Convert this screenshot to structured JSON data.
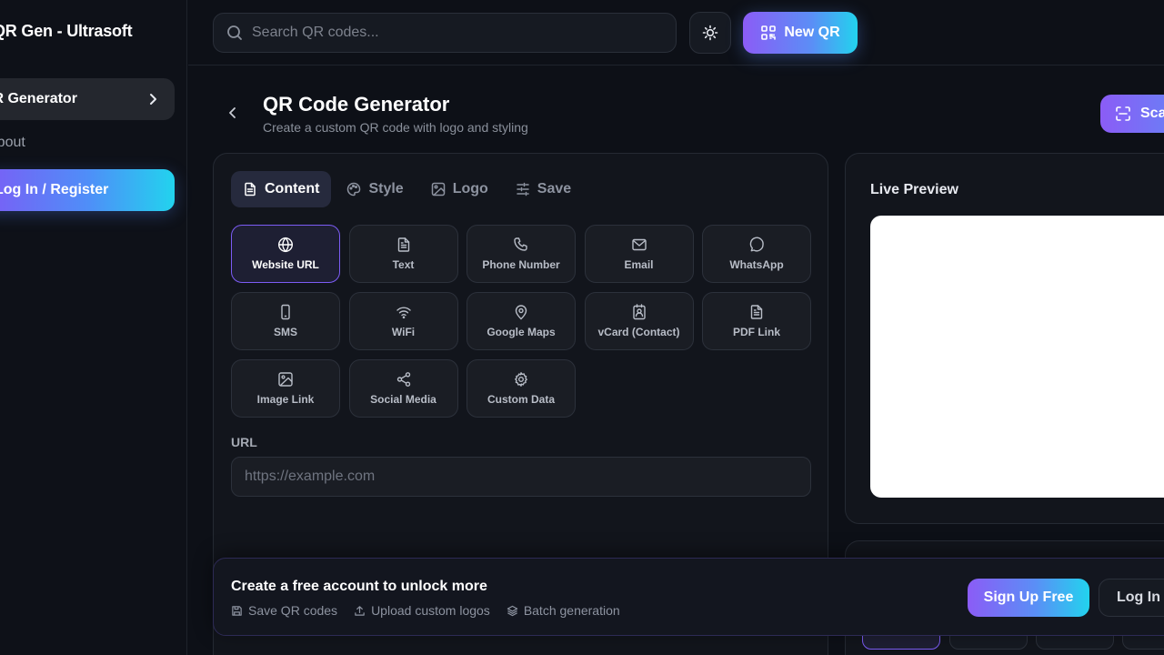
{
  "sidebar": {
    "brand": "QR Gen - Ultrasoft",
    "active_item": "QR Generator",
    "item_about": "About",
    "login_label": "Log In / Register"
  },
  "topbar": {
    "search_placeholder": "Search QR codes...",
    "new_qr_label": "New QR"
  },
  "page": {
    "title": "QR Code Generator",
    "subtitle": "Create a custom QR code with logo and styling",
    "scan_label": "Scan"
  },
  "tabs": [
    {
      "label": "Content",
      "icon": "file-text-icon",
      "active": true
    },
    {
      "label": "Style",
      "icon": "palette-icon",
      "active": false
    },
    {
      "label": "Logo",
      "icon": "image-icon",
      "active": false
    },
    {
      "label": "Save",
      "icon": "sliders-icon",
      "active": false
    }
  ],
  "types": [
    {
      "label": "Website URL",
      "icon": "globe-icon"
    },
    {
      "label": "Text",
      "icon": "file-text-icon"
    },
    {
      "label": "Phone Number",
      "icon": "phone-icon"
    },
    {
      "label": "Email",
      "icon": "mail-icon"
    },
    {
      "label": "WhatsApp",
      "icon": "message-circle-icon"
    },
    {
      "label": "SMS",
      "icon": "smartphone-icon"
    },
    {
      "label": "WiFi",
      "icon": "wifi-icon"
    },
    {
      "label": "Google Maps",
      "icon": "map-pin-icon"
    },
    {
      "label": "vCard (Contact)",
      "icon": "contact-card-icon"
    },
    {
      "label": "PDF Link",
      "icon": "file-pdf-icon"
    },
    {
      "label": "Image Link",
      "icon": "image-icon"
    },
    {
      "label": "Social Media",
      "icon": "share-icon"
    },
    {
      "label": "Custom Data",
      "icon": "gear-icon"
    }
  ],
  "selected_type": "Website URL",
  "url_field": {
    "label": "URL",
    "placeholder": "https://example.com",
    "value": ""
  },
  "preview": {
    "title": "Live Preview"
  },
  "banner": {
    "title": "Create a free account to unlock more",
    "features": [
      "Save QR codes",
      "Upload custom logos",
      "Batch generation"
    ],
    "signup_label": "Sign Up Free",
    "login_label": "Log In"
  },
  "colors": {
    "background": "#0d1017",
    "card": "#12151c",
    "accent_purple": "#8b5cf6",
    "accent_cyan": "#22d3ee",
    "preview_canvas": "#ffffff"
  }
}
